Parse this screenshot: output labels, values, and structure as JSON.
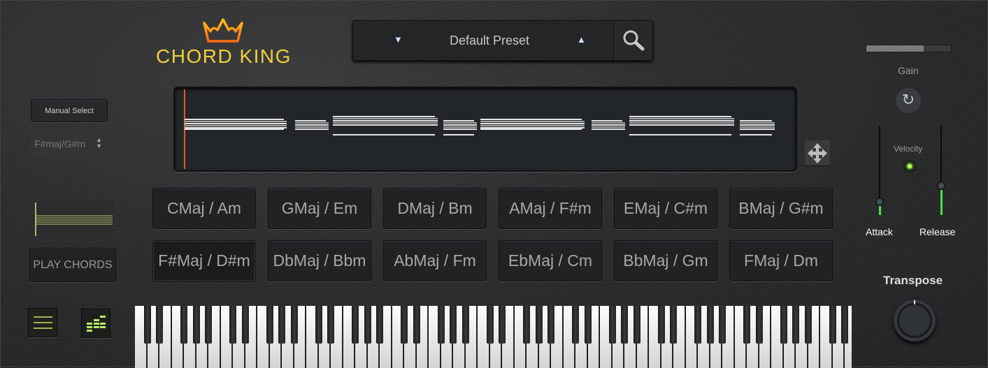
{
  "logo": {
    "text": "CHORD KING"
  },
  "preset": {
    "name": "Default Preset",
    "prev_icon": "▼",
    "next_icon": "▲"
  },
  "left_panel": {
    "manual_select_label": "Manual Select",
    "key_select_value": "F#maj/G#m",
    "play_chords_label": "PLAY CHORDS"
  },
  "chords": {
    "row1": [
      "CMaj / Am",
      "GMaj / Em",
      "DMaj / Bm",
      "AMaj / F#m",
      "EMaj / C#m",
      "BMaj / G#m"
    ],
    "row2": [
      "F#Maj / D#m",
      "DbMaj / Bbm",
      "AbMaj / Fm",
      "EbMaj / Cm",
      "BbMaj / Gm",
      "FMaj / Dm"
    ],
    "active": "F#Maj / D#m"
  },
  "right_panel": {
    "gain_label": "Gain",
    "gain_value": 0.68,
    "velocity_label": "Velocity",
    "velocity_on": true,
    "attack_label": "Attack",
    "attack_value": 0.15,
    "release_label": "Release",
    "release_value": 0.33,
    "transpose_label": "Transpose"
  },
  "colors": {
    "accent_green": "#4fe04a",
    "playhead": "#e8591a",
    "logo": "#f1cf3a"
  }
}
